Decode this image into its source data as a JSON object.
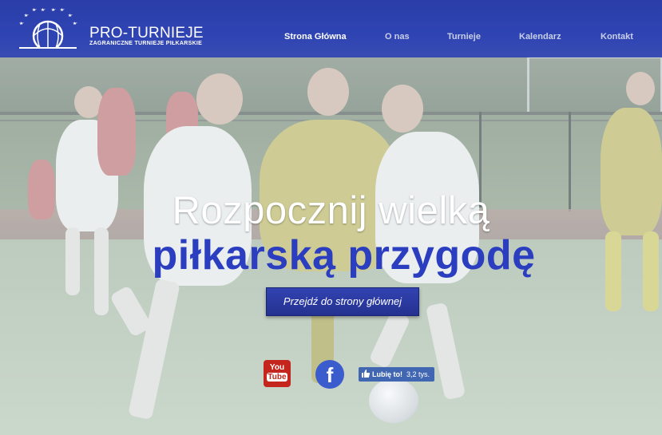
{
  "brand": {
    "title": "PRO-TURNIEJE",
    "subtitle": "ZAGRANICZNE TURNIEJE PIŁKARSKIE"
  },
  "nav": {
    "items": [
      {
        "label": "Strona Główna"
      },
      {
        "label": "O nas"
      },
      {
        "label": "Turnieje"
      },
      {
        "label": "Kalendarz"
      },
      {
        "label": "Kontakt"
      }
    ]
  },
  "hero": {
    "headline": "Rozpocznij wielką",
    "subheadline": "piłkarską przygodę",
    "cta_label": "Przejdź do strony głównej"
  },
  "social": {
    "youtube_top": "You",
    "youtube_bottom": "Tube",
    "facebook_glyph": "f",
    "like_label": "Lubię to!",
    "like_count": "3,2 tys."
  },
  "colors": {
    "nav_bg": "#2f44b3",
    "accent_blue": "#2b3ec0",
    "youtube_red": "#c4261d",
    "facebook_blue": "#3b5ccc"
  }
}
